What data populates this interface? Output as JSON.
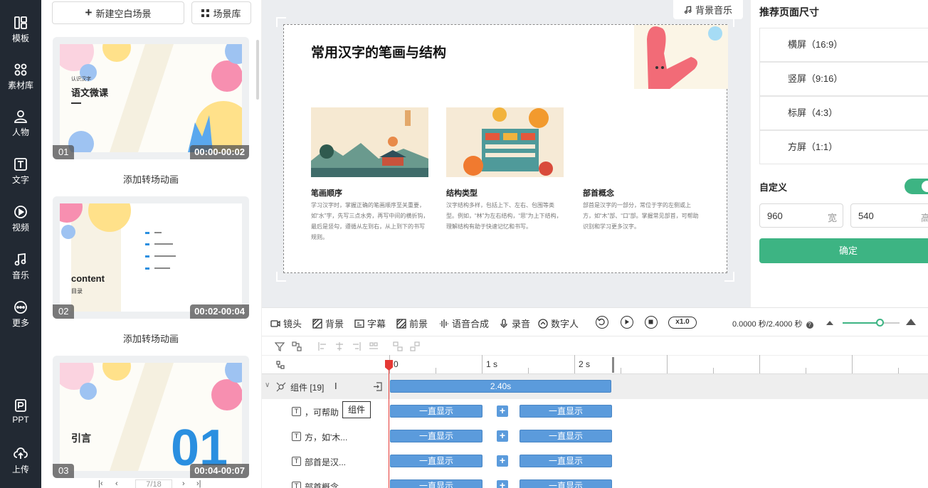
{
  "rail": [
    {
      "label": "模板",
      "icon": "template-icon"
    },
    {
      "label": "素材库",
      "icon": "material-icon"
    },
    {
      "label": "人物",
      "icon": "person-icon"
    },
    {
      "label": "文字",
      "icon": "text-icon"
    },
    {
      "label": "视频",
      "icon": "video-icon"
    },
    {
      "label": "音乐",
      "icon": "music-icon"
    },
    {
      "label": "更多",
      "icon": "more-icon"
    },
    {
      "label": "PPT",
      "icon": "ppt-icon"
    },
    {
      "label": "上传",
      "icon": "upload-icon"
    }
  ],
  "scenes": {
    "new_blank": "新建空白场景",
    "library": "场景库",
    "add_transition": "添加转场动画",
    "items": [
      {
        "index": "01",
        "time": "00:00-00:02",
        "title": "语文微课",
        "subtitle": "认识汉字"
      },
      {
        "index": "02",
        "time": "00:02-00:04",
        "title": "content",
        "subtitle": "目录"
      },
      {
        "index": "03",
        "time": "00:04-00:07",
        "title": "引言",
        "subtitle": "01"
      }
    ],
    "pager": "7/18"
  },
  "stage": {
    "bgm": "背景音乐",
    "slide": {
      "title": "常用汉字的笔画与结构",
      "columns": [
        {
          "heading": "笔画顺序",
          "text": "学习汉字时，掌握正确的笔画顺序至关重要，如“水”字，先写三点水旁，再写中间的横折钩，最后是竖勾，遵循从左到右，从上到下的书写规则。"
        },
        {
          "heading": "结构类型",
          "text": "汉字结构多样，包括上下、左右、包围等类型。例如，“林”为左右结构，“思”为上下结构，理解结构有助于快速记忆和书写。"
        },
        {
          "heading": "部首概念",
          "text": "部首是汉字的一部分，常位于字的左侧或上方，如“木”部、“口”部。掌握常见部首，可帮助识别和学习更多汉字。"
        }
      ]
    }
  },
  "right_panel": {
    "title": "推荐页面尺寸",
    "ratios": [
      "横屏（16:9）",
      "竖屏（9:16）",
      "标屏（4:3）",
      "方屏（1:1）"
    ],
    "custom_label": "自定义",
    "custom_enabled": true,
    "width_value": "960",
    "width_unit": "宽",
    "height_value": "540",
    "height_unit": "高",
    "confirm": "确定"
  },
  "timeline": {
    "tabs": [
      "镜头",
      "背景",
      "字幕",
      "前景",
      "语音合成",
      "录音",
      "数字人"
    ],
    "speed": "x1.0",
    "time": "0.0000 秒/2.4000 秒",
    "zoom_level": 0.65,
    "ruler": [
      "0",
      "1 s",
      "2 s"
    ],
    "group_label": "组件 [19]",
    "group_duration": "2.40s",
    "tooltip": "组件",
    "rows": [
      {
        "label": "，可帮助",
        "bar1": "一直显示",
        "bar2": "一直显示"
      },
      {
        "label": "方，如'木...",
        "bar1": "一直显示",
        "bar2": "一直显示"
      },
      {
        "label": "部首是汉...",
        "bar1": "一直显示",
        "bar2": "一直显示"
      },
      {
        "label": "部首概念",
        "bar1": "一直显示",
        "bar2": "一直显示"
      }
    ]
  }
}
